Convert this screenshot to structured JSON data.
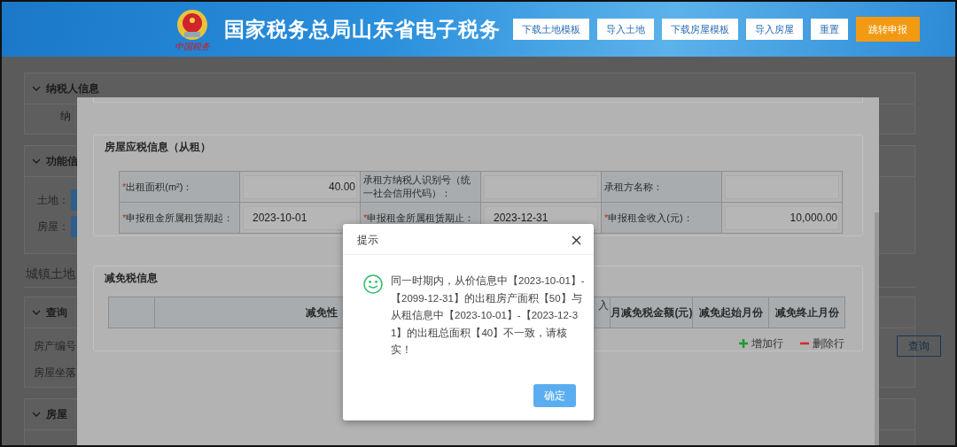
{
  "header": {
    "logo_caption": "中国税务",
    "title": "国家税务总局山东省电子税务",
    "buttons": [
      {
        "label": "下载土地模板",
        "kind": "plain"
      },
      {
        "label": "导入土地",
        "kind": "plain"
      },
      {
        "label": "下载房屋模板",
        "kind": "plain"
      },
      {
        "label": "导入房屋",
        "kind": "plain"
      },
      {
        "label": "重置",
        "kind": "plain"
      },
      {
        "label": "跳转申报",
        "kind": "primary"
      }
    ]
  },
  "page": {
    "taxpayer_panel": {
      "title": "纳税人信息",
      "label": "纳"
    },
    "function_panel": {
      "title": "功能信",
      "rows": [
        "土地：",
        "房屋："
      ]
    },
    "section_title": "城镇土地",
    "query_panel": {
      "title": "查询",
      "fields": [
        "房产编号",
        "房屋坐落"
      ],
      "button": "查询"
    },
    "house_panel": {
      "title": "房屋"
    }
  },
  "modal": {
    "rent_section": {
      "title": "房屋应税信息（从租）",
      "fields": [
        {
          "required_mark": "*",
          "label": "出租面积(m²)：",
          "kind": "number",
          "value": "40.00"
        },
        {
          "label": "承租方纳税人识别号（统一社会信用代码）：",
          "kind": "text"
        },
        {
          "label": "承租方名称：",
          "kind": "text"
        },
        {
          "required_mark": "*",
          "label": "申报租金所属租赁期起：",
          "kind": "date",
          "value": "2023-10-01"
        },
        {
          "required_mark": "*",
          "label": "申报租金所属租赁期止：",
          "kind": "date",
          "value": "2023-12-31"
        },
        {
          "required_mark": "*",
          "label": "申报租金收入(元)：",
          "kind": "number",
          "value": "10,000.00"
        }
      ]
    },
    "relief_section": {
      "title": "减免税信息",
      "columns": [
        {
          "label": "减免性",
          "kind": "wide"
        },
        {
          "label": "入",
          "kind": "cut"
        },
        {
          "label": "月减免税金额(元)",
          "kind": "normal"
        },
        {
          "label": "减免起始月份",
          "kind": "normal"
        },
        {
          "label": "减免终止月份",
          "kind": "normal"
        }
      ],
      "actions": [
        {
          "label": "增加行",
          "kind": "add"
        },
        {
          "label": "删除行",
          "kind": "remove"
        }
      ]
    }
  },
  "dialog": {
    "title": "提示",
    "message": "同一时期内，从价信息中【2023-10-01】-【2099-12-31】的出租房产面积【50】与从租信息中【2023-10-01】-【2023-12-31】的出租总面积【40】不一致，请核实！",
    "ok": "确定"
  }
}
